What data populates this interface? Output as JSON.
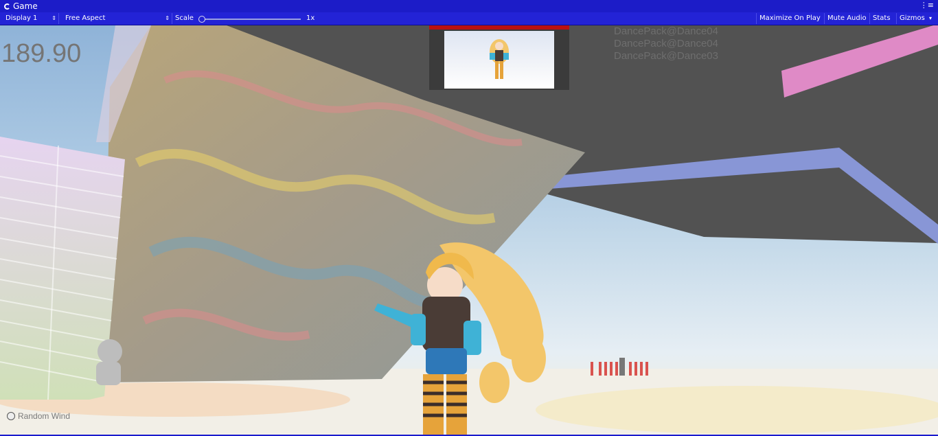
{
  "window": {
    "tab_title": "Game",
    "menu_glyph": "⋮≡"
  },
  "toolbar": {
    "display_select": "Display 1",
    "aspect_select": "Free Aspect",
    "scale_label": "Scale",
    "scale_value": "1x",
    "scale_level": 0.0,
    "maximize_label": "Maximize On Play",
    "mute_label": "Mute Audio",
    "stats_label": "Stats",
    "gizmos_label": "Gizmos",
    "dropdown_icon": "dropdown-arrow-icon"
  },
  "game": {
    "fps_value": "189.90",
    "animations": [
      "DancePack@Dance04",
      "DancePack@Dance04",
      "DancePack@Dance03"
    ],
    "random_wind_label": "Random Wind",
    "random_wind_checked": false
  },
  "colors": {
    "title_bg": "#1c1cc8",
    "toolbar_bg": "#2323d6"
  }
}
